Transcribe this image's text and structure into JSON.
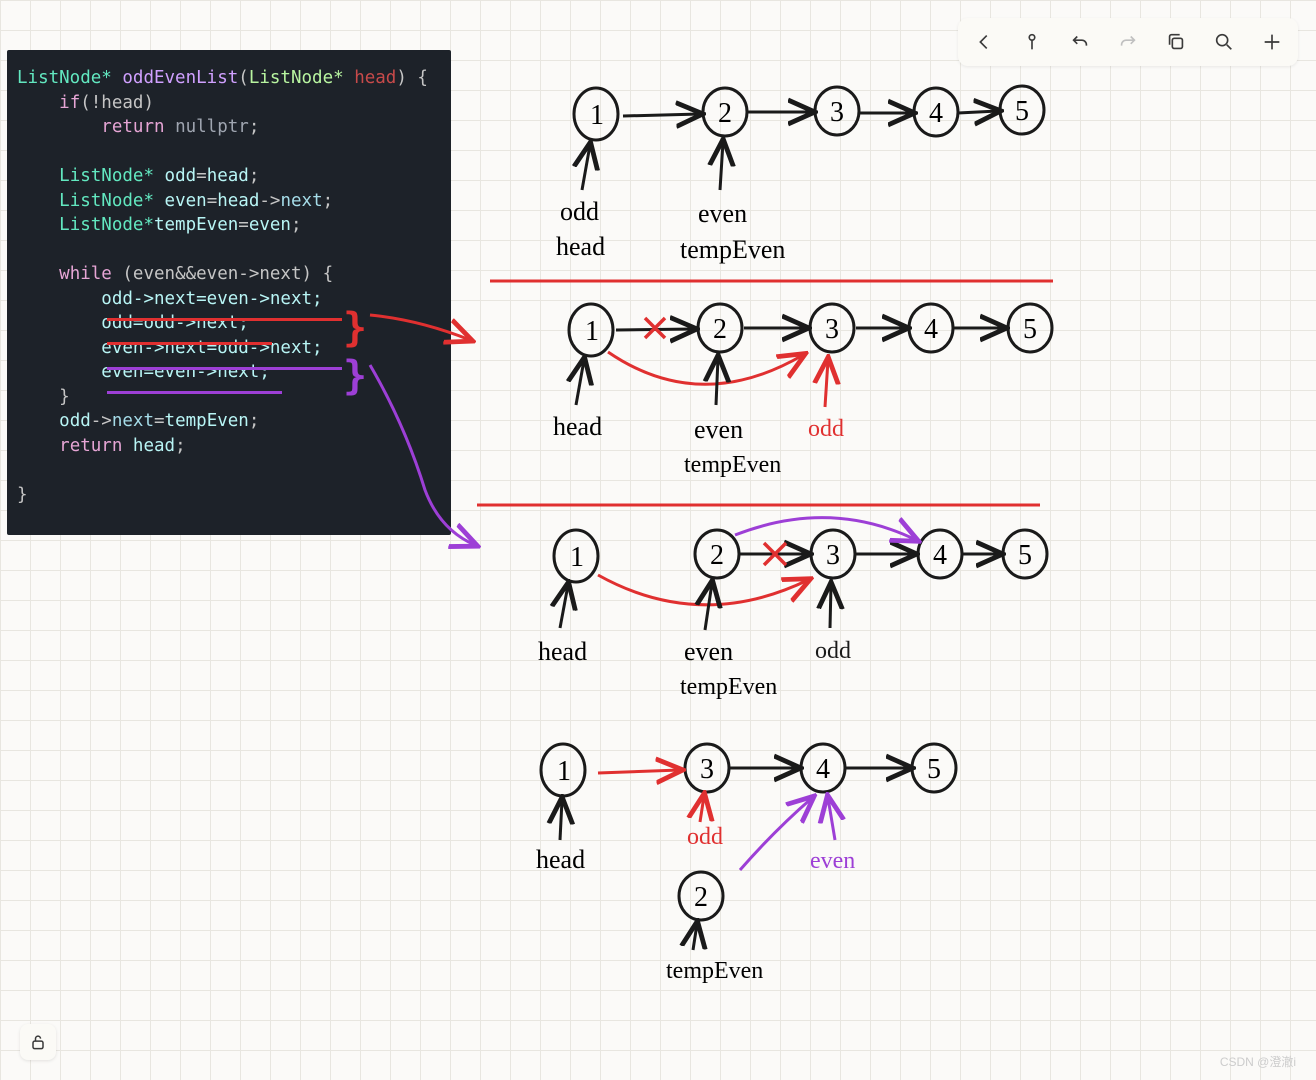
{
  "code": {
    "sig_type": "ListNode*",
    "sig_fn": "oddEvenList",
    "sig_par_type": "ListNode*",
    "sig_par": "head",
    "if_kw": "if",
    "if_cond": "(!head)",
    "ret_kw": "return",
    "null_kw": "nullptr",
    "decl1_type": "ListNode*",
    "decl1_name": "odd",
    "decl1_rhs": "head",
    "decl2_type": "ListNode*",
    "decl2_name": "even",
    "decl2_rhs": "head",
    "decl2_mem": "next",
    "decl3_type": "ListNode*",
    "decl3_name": "tempEven",
    "decl3_rhs": "even",
    "while_kw": "while",
    "while_cond": "(even&&even->next)",
    "stmt1": "odd->next=even->next;",
    "stmt2": "odd=odd->next;",
    "stmt3": "even->next=odd->next;",
    "stmt4": "even=even->next;",
    "stmt5_lhs": "odd",
    "stmt5_mem": "next",
    "stmt5_rhs": "tempEven",
    "ret2_kw": "return",
    "ret2_val": "head"
  },
  "diagram": {
    "nodes": [
      "1",
      "2",
      "3",
      "4",
      "5"
    ],
    "labels": {
      "odd": "odd",
      "head": "head",
      "even": "even",
      "tempEven": "tempEven"
    },
    "step1": {
      "nodes": [
        1,
        2,
        3,
        4,
        5
      ],
      "labels": {
        "1": [
          "odd",
          "head"
        ],
        "2": [
          "even",
          "tempEven"
        ]
      }
    },
    "step2": {
      "nodes": [
        1,
        2,
        3,
        4,
        5
      ],
      "cross": "1-2",
      "newlink": "1-3",
      "labels": {
        "1": [
          "head"
        ],
        "2": [
          "even",
          "tempEven"
        ],
        "3": [
          "odd"
        ]
      }
    },
    "step3": {
      "nodes": [
        1,
        2,
        3,
        4,
        5
      ],
      "cross": "2-3",
      "newlinks": [
        "1-3",
        "2-4"
      ],
      "labels": {
        "1": [
          "head"
        ],
        "2": [
          "even",
          "tempEven"
        ],
        "3": [
          "odd"
        ]
      }
    },
    "step4": {
      "nodes": [
        1,
        3,
        4,
        5
      ],
      "extra": 2,
      "labels": {
        "1": [
          "head"
        ],
        "3": [
          "odd"
        ],
        "4": [
          "even"
        ],
        "2": [
          "tempEven"
        ]
      }
    }
  },
  "watermark": "CSDN @澄澈i"
}
